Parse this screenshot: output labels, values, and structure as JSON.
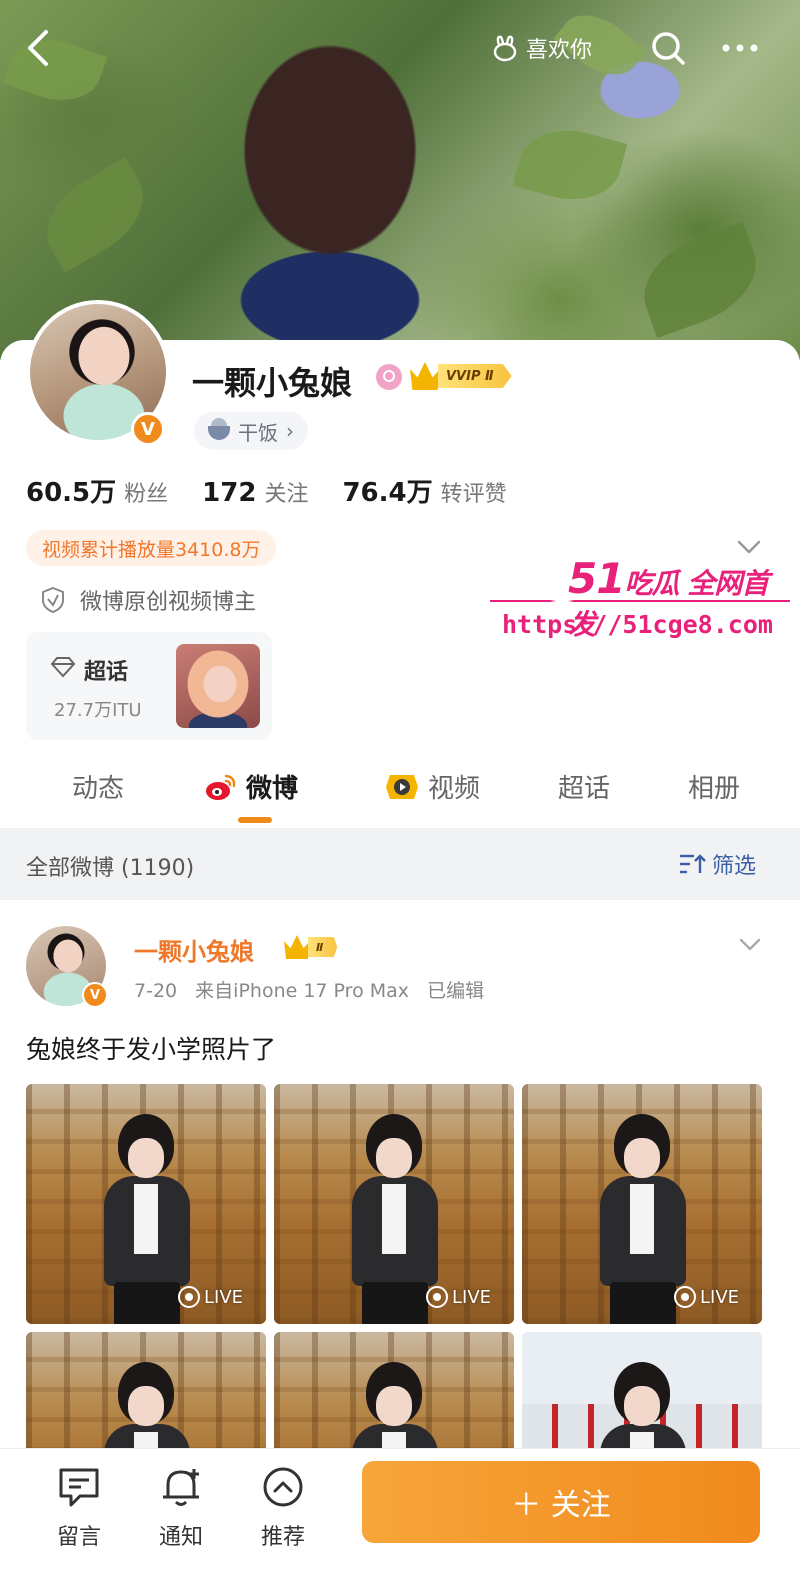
{
  "topbar": {
    "like_label": "喜欢你"
  },
  "profile": {
    "name": "一颗小兔娘",
    "vip_tag": "VVIP Ⅱ",
    "tag": "干饭",
    "stats": [
      {
        "value": "60.5万",
        "label": "粉丝"
      },
      {
        "value": "172",
        "label": "关注"
      },
      {
        "value": "76.4万",
        "label": "转评赞"
      }
    ],
    "play_count": "视频累计播放量3410.8万",
    "creator_label": "微博原创视频博主",
    "chaohua": {
      "title": "超话",
      "count": "27.7万ITU"
    }
  },
  "watermark": {
    "number": "51",
    "text": "吃瓜 全网首发",
    "url": "https://51cge8.com"
  },
  "tabs": [
    {
      "label": "动态"
    },
    {
      "label": "微博",
      "active": true
    },
    {
      "label": "视频"
    },
    {
      "label": "超话"
    },
    {
      "label": "相册"
    }
  ],
  "filter": {
    "title": "全部微博 (1190)",
    "button": "筛选"
  },
  "post": {
    "author": "一颗小兔娘",
    "vip_tag": "Ⅱ",
    "date": "7-20",
    "source": "来自iPhone 17 Pro Max",
    "edited": "已编辑",
    "text": "兔娘终于发小学照片了",
    "images": [
      {
        "badge": "LIVE"
      },
      {
        "badge": "LIVE"
      },
      {
        "badge": "LIVE"
      },
      {
        "badge": ""
      },
      {
        "badge": ""
      },
      {
        "badge": ""
      }
    ]
  },
  "bottombar": {
    "items": [
      {
        "label": "留言",
        "icon": "message-icon"
      },
      {
        "label": "通知",
        "icon": "bell-plus-icon"
      },
      {
        "label": "推荐",
        "icon": "chevron-up-circle-icon"
      }
    ],
    "follow_label": "＋ 关注"
  },
  "colors": {
    "accent": "#f08a1c",
    "link_blue": "#3b5fa6",
    "watermark": "#e8227a"
  }
}
